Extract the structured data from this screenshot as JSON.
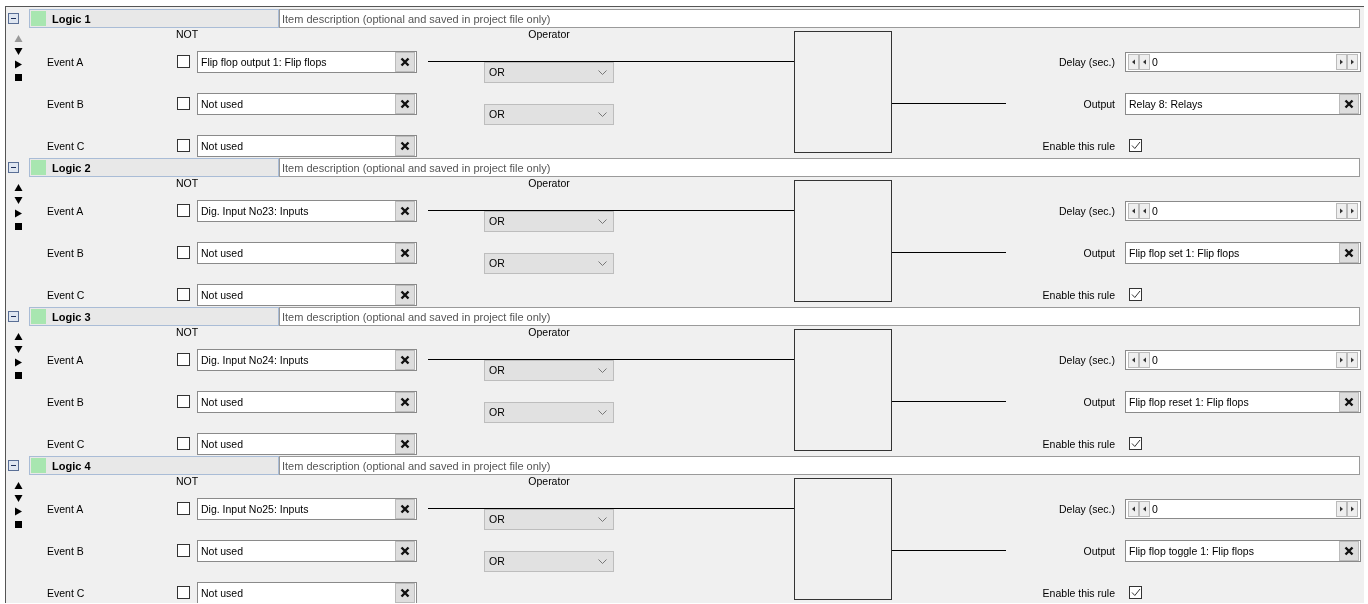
{
  "logic_blocks": [
    {
      "title": "Logic 1",
      "color": "#a8e6b0",
      "can_move_up": false,
      "description_placeholder": "Item description (optional and saved in project file only)",
      "not_label": "NOT",
      "operator_label": "Operator",
      "events": [
        {
          "label": "Event A",
          "not": false,
          "wired": true,
          "value": "Flip flop output 1: Flip flops"
        },
        {
          "label": "Event B",
          "not": false,
          "wired": false,
          "value": "Not used"
        },
        {
          "label": "Event C",
          "not": false,
          "wired": false,
          "value": "Not used"
        }
      ],
      "operators": [
        "OR",
        "OR"
      ],
      "delay_label": "Delay (sec.)",
      "delay_value": "0",
      "output_label": "Output",
      "output_value": "Relay 8: Relays",
      "enable_label": "Enable this rule",
      "enabled": true
    },
    {
      "title": "Logic 2",
      "color": "#a8e6b0",
      "can_move_up": true,
      "description_placeholder": "Item description (optional and saved in project file only)",
      "not_label": "NOT",
      "operator_label": "Operator",
      "events": [
        {
          "label": "Event A",
          "not": false,
          "wired": true,
          "value": "Dig. Input No23: Inputs"
        },
        {
          "label": "Event B",
          "not": false,
          "wired": false,
          "value": "Not used"
        },
        {
          "label": "Event C",
          "not": false,
          "wired": false,
          "value": "Not used"
        }
      ],
      "operators": [
        "OR",
        "OR"
      ],
      "delay_label": "Delay (sec.)",
      "delay_value": "0",
      "output_label": "Output",
      "output_value": "Flip flop set 1: Flip flops",
      "enable_label": "Enable this rule",
      "enabled": true
    },
    {
      "title": "Logic 3",
      "color": "#a8e6b0",
      "can_move_up": true,
      "description_placeholder": "Item description (optional and saved in project file only)",
      "not_label": "NOT",
      "operator_label": "Operator",
      "events": [
        {
          "label": "Event A",
          "not": false,
          "wired": true,
          "value": "Dig. Input No24: Inputs"
        },
        {
          "label": "Event B",
          "not": false,
          "wired": false,
          "value": "Not used"
        },
        {
          "label": "Event C",
          "not": false,
          "wired": false,
          "value": "Not used"
        }
      ],
      "operators": [
        "OR",
        "OR"
      ],
      "delay_label": "Delay (sec.)",
      "delay_value": "0",
      "output_label": "Output",
      "output_value": "Flip flop reset 1: Flip flops",
      "enable_label": "Enable this rule",
      "enabled": true
    },
    {
      "title": "Logic 4",
      "color": "#a8e6b0",
      "can_move_up": true,
      "description_placeholder": "Item description (optional and saved in project file only)",
      "not_label": "NOT",
      "operator_label": "Operator",
      "events": [
        {
          "label": "Event A",
          "not": false,
          "wired": true,
          "value": "Dig. Input No25: Inputs"
        },
        {
          "label": "Event B",
          "not": false,
          "wired": false,
          "value": "Not used"
        },
        {
          "label": "Event C",
          "not": false,
          "wired": false,
          "value": "Not used"
        }
      ],
      "operators": [
        "OR",
        "OR"
      ],
      "delay_label": "Delay (sec.)",
      "delay_value": "0",
      "output_label": "Output",
      "output_value": "Flip flop toggle 1: Flip flops",
      "enable_label": "Enable this rule",
      "enabled": true
    }
  ]
}
